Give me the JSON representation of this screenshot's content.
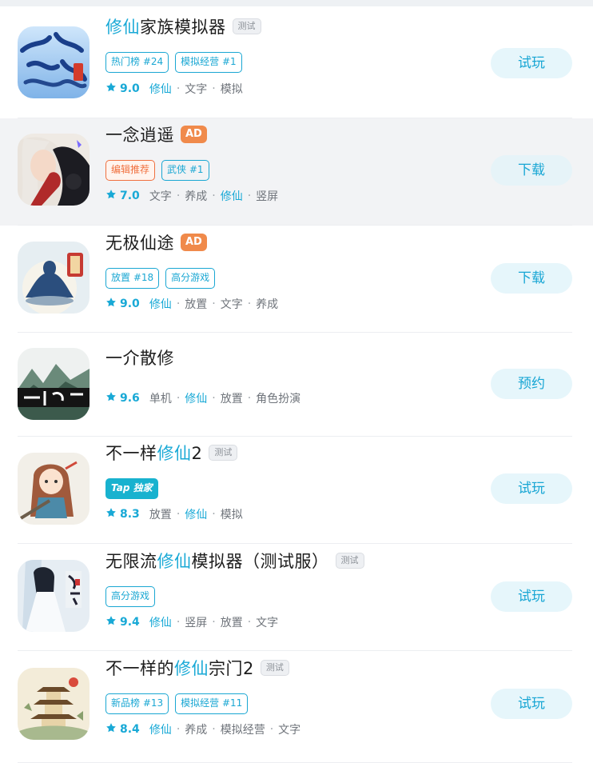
{
  "games": [
    {
      "title_parts": [
        {
          "text": "修仙",
          "hl": true
        },
        {
          "text": "家族模拟器",
          "hl": false
        }
      ],
      "badge": "测试",
      "ad": "",
      "tags": [
        {
          "text": "热门榜 #24",
          "style": "blue"
        },
        {
          "text": "模拟经营 #1",
          "style": "blue"
        }
      ],
      "rating": "9.0",
      "meta": [
        {
          "text": "修仙",
          "hl": true
        },
        {
          "text": "文字",
          "hl": false
        },
        {
          "text": "模拟",
          "hl": false
        }
      ],
      "button": "试玩"
    },
    {
      "title_parts": [
        {
          "text": "一念逍遥",
          "hl": false
        }
      ],
      "badge": "",
      "ad": "AD",
      "tags": [
        {
          "text": "编辑推荐",
          "style": "red"
        },
        {
          "text": "武侠 #1",
          "style": "blue"
        }
      ],
      "rating": "7.0",
      "meta": [
        {
          "text": "文字",
          "hl": false
        },
        {
          "text": "养成",
          "hl": false
        },
        {
          "text": "修仙",
          "hl": true
        },
        {
          "text": "竖屏",
          "hl": false
        }
      ],
      "button": "下载"
    },
    {
      "title_parts": [
        {
          "text": "无极仙途",
          "hl": false
        }
      ],
      "badge": "",
      "ad": "AD",
      "tags": [
        {
          "text": "放置 #18",
          "style": "blue"
        },
        {
          "text": "高分游戏",
          "style": "blue"
        }
      ],
      "rating": "9.0",
      "meta": [
        {
          "text": "修仙",
          "hl": true
        },
        {
          "text": "放置",
          "hl": false
        },
        {
          "text": "文字",
          "hl": false
        },
        {
          "text": "养成",
          "hl": false
        }
      ],
      "button": "下载"
    },
    {
      "title_parts": [
        {
          "text": "一介散修",
          "hl": false
        }
      ],
      "badge": "",
      "ad": "",
      "tags": [],
      "rating": "9.6",
      "meta": [
        {
          "text": "单机",
          "hl": false
        },
        {
          "text": "修仙",
          "hl": true
        },
        {
          "text": "放置",
          "hl": false
        },
        {
          "text": "角色扮演",
          "hl": false
        }
      ],
      "button": "预约"
    },
    {
      "title_parts": [
        {
          "text": "不一样",
          "hl": false
        },
        {
          "text": "修仙",
          "hl": true
        },
        {
          "text": "2",
          "hl": false
        }
      ],
      "badge": "测试",
      "ad": "",
      "tags": [
        {
          "text": "Tap 独家",
          "style": "solid"
        }
      ],
      "rating": "8.3",
      "meta": [
        {
          "text": "放置",
          "hl": false
        },
        {
          "text": "修仙",
          "hl": true
        },
        {
          "text": "模拟",
          "hl": false
        }
      ],
      "button": "试玩"
    },
    {
      "title_parts": [
        {
          "text": "无限流",
          "hl": false
        },
        {
          "text": "修仙",
          "hl": true
        },
        {
          "text": "模拟器（测试服）",
          "hl": false
        }
      ],
      "badge": "测试",
      "ad": "",
      "tags": [
        {
          "text": "高分游戏",
          "style": "blue"
        }
      ],
      "rating": "9.4",
      "meta": [
        {
          "text": "修仙",
          "hl": true
        },
        {
          "text": "竖屏",
          "hl": false
        },
        {
          "text": "放置",
          "hl": false
        },
        {
          "text": "文字",
          "hl": false
        }
      ],
      "button": "试玩"
    },
    {
      "title_parts": [
        {
          "text": "不一样的",
          "hl": false
        },
        {
          "text": "修仙",
          "hl": true
        },
        {
          "text": "宗门2",
          "hl": false
        }
      ],
      "badge": "测试",
      "ad": "",
      "tags": [
        {
          "text": "新品榜 #13",
          "style": "blue"
        },
        {
          "text": "模拟经营 #11",
          "style": "blue"
        }
      ],
      "rating": "8.4",
      "meta": [
        {
          "text": "修仙",
          "hl": true
        },
        {
          "text": "养成",
          "hl": false
        },
        {
          "text": "模拟经营",
          "hl": false
        },
        {
          "text": "文字",
          "hl": false
        }
      ],
      "button": "试玩"
    }
  ],
  "icons": [
    "game-icon-xiuxian-family",
    "game-icon-yinian-xiaoyao",
    "game-icon-wuji-xiantu",
    "game-icon-yijie-sanxiu",
    "game-icon-buyiyang-xiuxian",
    "game-icon-wuxianliu-xiuxian",
    "game-icon-buyiyang-zongmen"
  ],
  "colors": {
    "accent": "#19a9d6",
    "ad": "#f08a4b",
    "editor_tag": "#f0703f",
    "button_bg": "#e6f6fb"
  }
}
